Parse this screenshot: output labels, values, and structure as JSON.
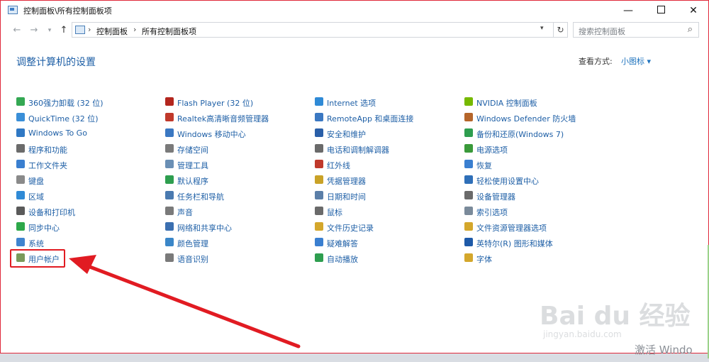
{
  "window": {
    "title": "控制面板\\所有控制面板项",
    "minimize": "—",
    "close": "✕"
  },
  "address": {
    "crumbs": [
      "控制面板",
      "所有控制面板项"
    ],
    "separator": "›",
    "search_placeholder": "搜索控制面板"
  },
  "content": {
    "heading": "调整计算机的设置",
    "view_by_label": "查看方式:",
    "view_mode": "小图标 ▾"
  },
  "columns": [
    [
      {
        "label": "360强力卸载 (32 位)",
        "icon": "green-circle-icon",
        "color": "#34a853"
      },
      {
        "label": "QuickTime (32 位)",
        "icon": "quicktime-icon",
        "color": "#3a8fd8"
      },
      {
        "label": "Windows To Go",
        "icon": "windows-to-go-icon",
        "color": "#2f78c4"
      },
      {
        "label": "程序和功能",
        "icon": "programs-icon",
        "color": "#6b6b6b"
      },
      {
        "label": "工作文件夹",
        "icon": "folder-icon",
        "color": "#3a7fd0"
      },
      {
        "label": "键盘",
        "icon": "keyboard-icon",
        "color": "#8a8a8a"
      },
      {
        "label": "区域",
        "icon": "globe-icon",
        "color": "#2f8ad6"
      },
      {
        "label": "设备和打印机",
        "icon": "printer-icon",
        "color": "#5a5a5a"
      },
      {
        "label": "同步中心",
        "icon": "sync-icon",
        "color": "#2da84a"
      },
      {
        "label": "系统",
        "icon": "system-icon",
        "color": "#3f84cf"
      },
      {
        "label": "用户帐户",
        "icon": "users-icon",
        "color": "#7a9a5a"
      }
    ],
    [
      {
        "label": "Flash Player (32 位)",
        "icon": "flash-icon",
        "color": "#b3261e"
      },
      {
        "label": "Realtek高清晰音频管理器",
        "icon": "speaker-icon",
        "color": "#c0392b"
      },
      {
        "label": "Windows 移动中心",
        "icon": "mobility-icon",
        "color": "#3b78c2"
      },
      {
        "label": "存储空间",
        "icon": "storage-icon",
        "color": "#7a7a7a"
      },
      {
        "label": "管理工具",
        "icon": "tools-icon",
        "color": "#6a8fb5"
      },
      {
        "label": "默认程序",
        "icon": "default-programs-icon",
        "color": "#2e9e4f"
      },
      {
        "label": "任务栏和导航",
        "icon": "taskbar-icon",
        "color": "#4a7ab0"
      },
      {
        "label": "声音",
        "icon": "sound-icon",
        "color": "#7a7a7a"
      },
      {
        "label": "网络和共享中心",
        "icon": "network-icon",
        "color": "#3b6fb0"
      },
      {
        "label": "颜色管理",
        "icon": "color-icon",
        "color": "#3a86c8"
      },
      {
        "label": "语音识别",
        "icon": "microphone-icon",
        "color": "#7a7a7a"
      }
    ],
    [
      {
        "label": "Internet 选项",
        "icon": "internet-icon",
        "color": "#2f8ad6"
      },
      {
        "label": "RemoteApp 和桌面连接",
        "icon": "remote-icon",
        "color": "#3b78c2"
      },
      {
        "label": "安全和维护",
        "icon": "flag-icon",
        "color": "#2a5fa8"
      },
      {
        "label": "电话和调制解调器",
        "icon": "phone-icon",
        "color": "#6a6a6a"
      },
      {
        "label": "红外线",
        "icon": "infrared-icon",
        "color": "#c0392b"
      },
      {
        "label": "凭据管理器",
        "icon": "credential-icon",
        "color": "#c9a227"
      },
      {
        "label": "日期和时间",
        "icon": "clock-icon",
        "color": "#5b7fa8"
      },
      {
        "label": "鼠标",
        "icon": "mouse-icon",
        "color": "#6a6a6a"
      },
      {
        "label": "文件历史记录",
        "icon": "file-history-icon",
        "color": "#d4a72c"
      },
      {
        "label": "疑难解答",
        "icon": "troubleshoot-icon",
        "color": "#3a7fd0"
      },
      {
        "label": "自动播放",
        "icon": "autoplay-icon",
        "color": "#2e9e4f"
      }
    ],
    [
      {
        "label": "NVIDIA 控制面板",
        "icon": "nvidia-icon",
        "color": "#76b900"
      },
      {
        "label": "Windows Defender 防火墙",
        "icon": "firewall-icon",
        "color": "#b5652a"
      },
      {
        "label": "备份和还原(Windows 7)",
        "icon": "backup-icon",
        "color": "#2e9e4f"
      },
      {
        "label": "电源选项",
        "icon": "power-icon",
        "color": "#3a9a3a"
      },
      {
        "label": "恢复",
        "icon": "recovery-icon",
        "color": "#3a7fd0"
      },
      {
        "label": "轻松使用设置中心",
        "icon": "ease-of-access-icon",
        "color": "#2f6fb8"
      },
      {
        "label": "设备管理器",
        "icon": "device-manager-icon",
        "color": "#6a6a6a"
      },
      {
        "label": "索引选项",
        "icon": "indexing-icon",
        "color": "#7a8a9a"
      },
      {
        "label": "文件资源管理器选项",
        "icon": "explorer-options-icon",
        "color": "#d4a72c"
      },
      {
        "label": "英特尔(R) 图形和媒体",
        "icon": "intel-icon",
        "color": "#1e5aa8"
      },
      {
        "label": "字体",
        "icon": "font-icon",
        "color": "#d4a72c"
      }
    ]
  ],
  "watermark": {
    "brand": "Bai du 经验",
    "url": "jingyan.baidu.com",
    "activate": "激活 Windo"
  },
  "colors": {
    "link": "#1e5fa6",
    "highlight": "#e11b22"
  }
}
